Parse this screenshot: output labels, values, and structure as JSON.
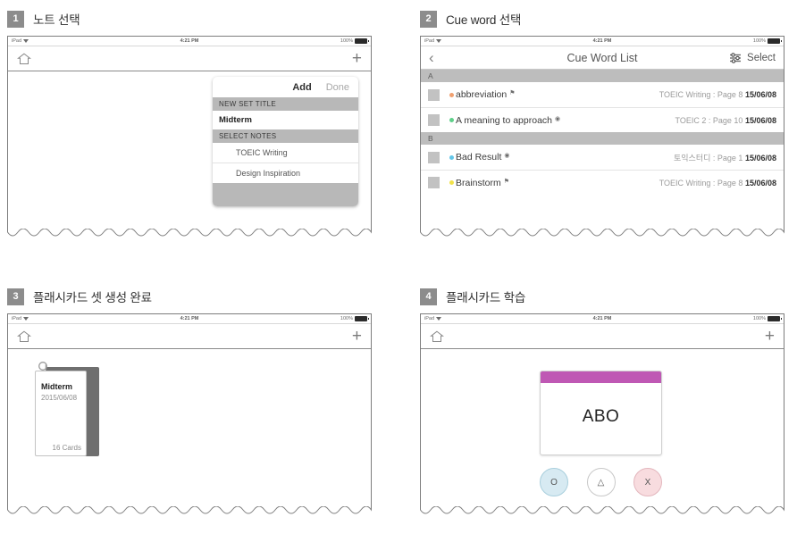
{
  "colors": {
    "badge_gray": "#8c8c8c",
    "section_gray": "#bdbdbd",
    "flash_header_purple": "#bf58b4",
    "answer_o_fill": "#d7eaf2",
    "answer_triangle_fill": "#ffffff",
    "answer_x_fill": "#f8dcdf",
    "dot_abbreviation": "#f0a070",
    "dot_approach": "#5fd08a",
    "dot_bad_result": "#63c6e8",
    "dot_brainstorm": "#f2e24a"
  },
  "status_bar": {
    "carrier": "iPad",
    "wifi_icon": "wifi-icon",
    "time": "4:21 PM",
    "battery_text": "100%",
    "battery_icon": "battery-full-icon"
  },
  "panels": [
    {
      "step": "1",
      "title": "노트 선택",
      "toolbar": {
        "home_icon": "home-icon",
        "add_icon": "plus-icon"
      },
      "popover": {
        "add_label": "Add",
        "done_label": "Done",
        "sections": [
          {
            "header": "NEW SET TITLE",
            "value": "Midterm"
          },
          {
            "header": "SELECT NOTES",
            "items": [
              "TOEIC Writing",
              "Design Inspiration"
            ]
          }
        ]
      }
    },
    {
      "step": "2",
      "title": "Cue word 선택",
      "navbar": {
        "back_icon": "chevron-left-icon",
        "title": "Cue Word List",
        "filter_icon": "filter-sliders-icon",
        "select_label": "Select"
      },
      "list": [
        {
          "section": "A",
          "rows": [
            {
              "checkbox": "checkbox-unchecked",
              "dot_color": "#f0a070",
              "word": "abbreviation",
              "badge_icon": "bookmark-flag-icon",
              "source": "TOEIC Writing : Page 8",
              "date": "15/06/08"
            },
            {
              "checkbox": "checkbox-unchecked",
              "dot_color": "#5fd08a",
              "word": "A meaning to approach",
              "badge_icon": "record-circle-icon",
              "source": "TOEIC 2 : Page 10",
              "date": "15/06/08"
            }
          ]
        },
        {
          "section": "B",
          "rows": [
            {
              "checkbox": "checkbox-unchecked",
              "dot_color": "#63c6e8",
              "word": "Bad Result",
              "badge_icon": "record-circle-icon",
              "source": "토익스터디 : Page 1",
              "date": "15/06/08"
            },
            {
              "checkbox": "checkbox-unchecked",
              "dot_color": "#f2e24a",
              "word": "Brainstorm",
              "badge_icon": "bookmark-flag-icon",
              "source": "TOEIC Writing : Page 8",
              "date": "15/06/08"
            }
          ]
        }
      ]
    },
    {
      "step": "3",
      "title": "플래시카드 셋 생성 완료",
      "toolbar": {
        "home_icon": "home-icon",
        "add_icon": "plus-icon"
      },
      "set_card": {
        "ring_icon": "ring-binder-icon",
        "title": "Midterm",
        "date": "2015/06/08",
        "count": "16 Cards"
      }
    },
    {
      "step": "4",
      "title": "플래시카드 학습",
      "toolbar": {
        "home_icon": "home-icon",
        "add_icon": "plus-icon"
      },
      "flashcard": {
        "word": "ABO",
        "header_color": "#bf58b4"
      },
      "answers": [
        {
          "name": "answer-correct",
          "glyph": "O",
          "fill": "#d7eaf2",
          "border": "#a9cfdd"
        },
        {
          "name": "answer-partial",
          "glyph": "△",
          "fill": "#ffffff",
          "border": "#c8c8c8"
        },
        {
          "name": "answer-wrong",
          "glyph": "X",
          "fill": "#f8dcdf",
          "border": "#e3b6bd"
        }
      ]
    }
  ]
}
